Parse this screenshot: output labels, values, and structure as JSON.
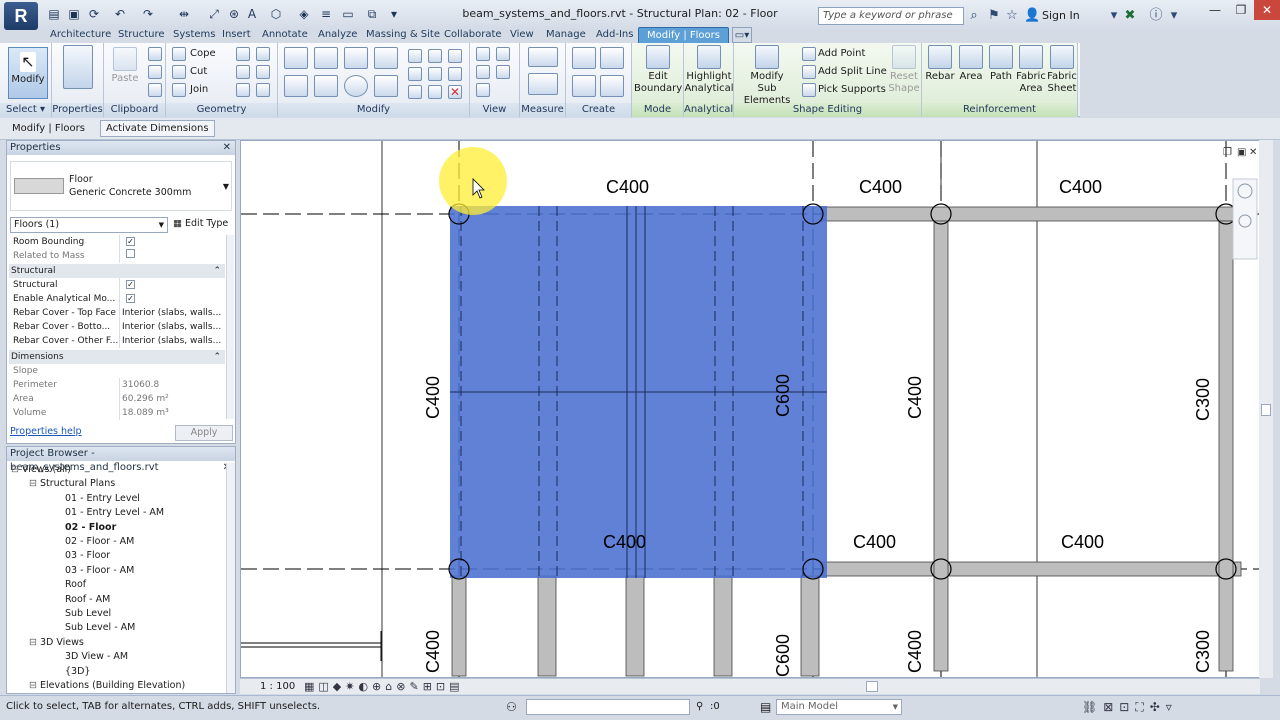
{
  "app": {
    "logo": "R",
    "title": "beam_systems_and_floors.rvt - Structural Plan: 02 - Floor",
    "search_placeholder": "Type a keyword or phrase",
    "sign_in": "Sign In"
  },
  "tabs": [
    {
      "label": "Architecture"
    },
    {
      "label": "Structure"
    },
    {
      "label": "Systems"
    },
    {
      "label": "Insert"
    },
    {
      "label": "Annotate"
    },
    {
      "label": "Analyze"
    },
    {
      "label": "Massing & Site"
    },
    {
      "label": "Collaborate"
    },
    {
      "label": "View"
    },
    {
      "label": "Manage"
    },
    {
      "label": "Add-Ins"
    },
    {
      "label": "Modify | Floors"
    }
  ],
  "ribbon": {
    "select": {
      "label": "Select",
      "modify": "Modify"
    },
    "properties": {
      "label": "Properties"
    },
    "clipboard": {
      "label": "Clipboard",
      "paste": "Paste"
    },
    "geometry": {
      "label": "Geometry",
      "cope": "Cope",
      "cut": "Cut",
      "join": "Join"
    },
    "modify": {
      "label": "Modify"
    },
    "view": {
      "label": "View"
    },
    "measure": {
      "label": "Measure"
    },
    "create": {
      "label": "Create"
    },
    "mode": {
      "label": "Mode",
      "edit_boundary_l1": "Edit",
      "edit_boundary_l2": "Boundary"
    },
    "analytical": {
      "label": "Analytical",
      "highlight_l1": "Highlight",
      "highlight_l2": "Analytical"
    },
    "shape_editing": {
      "label": "Shape Editing",
      "modify_sub_l1": "Modify",
      "modify_sub_l2": "Sub Elements",
      "add_point": "Add Point",
      "add_split_line": "Add Split Line",
      "pick_supports": "Pick Supports",
      "reset_l1": "Reset",
      "reset_l2": "Shape"
    },
    "reinforcement": {
      "label": "Reinforcement",
      "rebar": "Rebar",
      "area": "Area",
      "path": "Path",
      "fabric_area_l1": "Fabric",
      "fabric_area_l2": "Area",
      "fabric_sheet_l1": "Fabric",
      "fabric_sheet_l2": "Sheet"
    }
  },
  "options_bar": {
    "context": "Modify | Floors",
    "activate_dimensions": "Activate Dimensions"
  },
  "properties": {
    "title": "Properties",
    "type_family": "Floor",
    "type_name": "Generic Concrete 300mm",
    "filter": "Floors (1)",
    "edit_type": "Edit Type",
    "rows_top": [
      {
        "key": "Room Bounding",
        "checked": true
      },
      {
        "key": "Related to Mass",
        "checked": false
      }
    ],
    "cat_structural": "Structural",
    "rows_structural": [
      {
        "key": "Structural",
        "checked": true
      },
      {
        "key": "Enable Analytical Mo...",
        "checked": true
      },
      {
        "key": "Rebar Cover - Top Face",
        "value": "Interior (slabs, walls..."
      },
      {
        "key": "Rebar Cover - Botto...",
        "value": "Interior (slabs, walls..."
      },
      {
        "key": "Rebar Cover - Other F...",
        "value": "Interior (slabs, walls..."
      }
    ],
    "cat_dimensions": "Dimensions",
    "rows_dimensions": [
      {
        "key": "Slope",
        "value": ""
      },
      {
        "key": "Perimeter",
        "value": "31060.8"
      },
      {
        "key": "Area",
        "value": "60.296 m²"
      },
      {
        "key": "Volume",
        "value": "18.089 m³"
      }
    ],
    "help": "Properties help",
    "apply": "Apply"
  },
  "browser": {
    "title": "Project Browser - beam_systems_and_floors.rvt",
    "nodes": [
      {
        "label": "Views (all)",
        "level": 0
      },
      {
        "label": "Structural Plans",
        "level": 1
      },
      {
        "label": "01 - Entry Level",
        "level": 2
      },
      {
        "label": "01 - Entry Level - AM",
        "level": 2
      },
      {
        "label": "02 - Floor",
        "level": 2,
        "bold": true
      },
      {
        "label": "02 - Floor - AM",
        "level": 2
      },
      {
        "label": "03 - Floor",
        "level": 2
      },
      {
        "label": "03 - Floor - AM",
        "level": 2
      },
      {
        "label": "Roof",
        "level": 2
      },
      {
        "label": "Roof - AM",
        "level": 2
      },
      {
        "label": "Sub Level",
        "level": 2
      },
      {
        "label": "Sub Level - AM",
        "level": 2
      },
      {
        "label": "3D Views",
        "level": 1
      },
      {
        "label": "3D View - AM",
        "level": 2
      },
      {
        "label": "{3D}",
        "level": 2
      },
      {
        "label": "Elevations (Building Elevation)",
        "level": 1
      }
    ]
  },
  "canvas": {
    "beam_labels_h": [
      "C400",
      "C400",
      "C400",
      "C400",
      "C400",
      "C400"
    ],
    "beam_labels_v": [
      "C400",
      "C600",
      "C400",
      "C300",
      "C400",
      "C600",
      "C400",
      "C300"
    ],
    "selection_color": "#4a6fd0"
  },
  "view_control": {
    "scale": "1 : 100"
  },
  "status": {
    "hint": "Click to select, TAB for alternates, CTRL adds, SHIFT unselects.",
    "count": ":0",
    "workset": "Main Model"
  }
}
